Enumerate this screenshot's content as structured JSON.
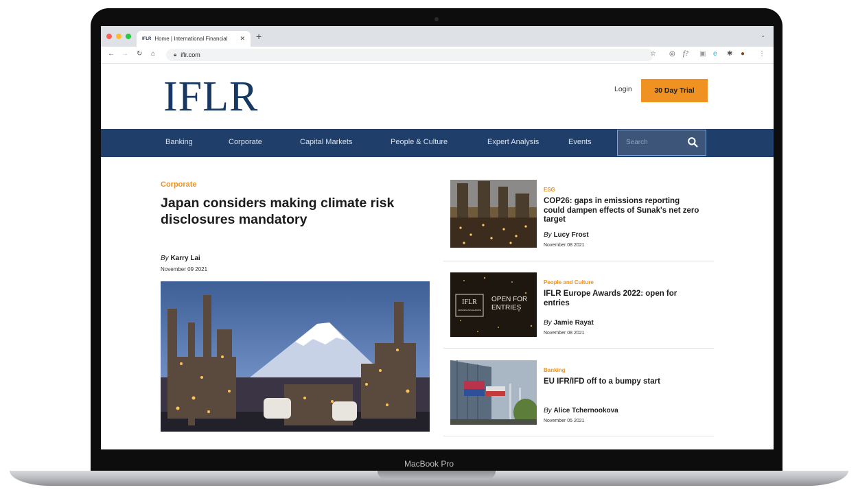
{
  "device": {
    "label": "MacBook Pro"
  },
  "browser": {
    "tab_title": "Home | International Financial",
    "tab_favicon": "IFLR",
    "new_tab": "+",
    "url": "iflr.com"
  },
  "site": {
    "logo": "IFLR",
    "login": "Login",
    "trial": "30 Day Trial",
    "nav": [
      "Banking",
      "Corporate",
      "Capital Markets",
      "People & Culture",
      "Expert Analysis",
      "Events"
    ],
    "search_placeholder": "Search"
  },
  "main_article": {
    "category": "Corporate",
    "title": "Japan considers making climate risk disclosures mandatory",
    "by_prefix": "By",
    "author": "Karry Lai",
    "date": "November 09 2021"
  },
  "side_articles": [
    {
      "category": "ESG",
      "title": "COP26: gaps in emissions reporting could dampen effects of Sunak's net zero target",
      "by_prefix": "By",
      "author": "Lucy Frost",
      "date": "November 08 2021"
    },
    {
      "category": "People and Culture",
      "title": "IFLR Europe Awards 2022: open for entries",
      "by_prefix": "By",
      "author": "Jamie Rayat",
      "date": "November 08 2021",
      "thumb_text": {
        "logo": "IFLR",
        "sub": "AWARDS 2022 EUROPE",
        "line1": "OPEN FOR",
        "line2": "ENTRIES"
      }
    },
    {
      "category": "Banking",
      "title": "EU IFR/IFD off to a bumpy start",
      "by_prefix": "By",
      "author": "Alice Tchernookova",
      "date": "November 05 2021"
    }
  ],
  "colors": {
    "brand_navy": "#1f3f6a",
    "accent_orange": "#ef9221",
    "logo_navy": "#183864"
  }
}
